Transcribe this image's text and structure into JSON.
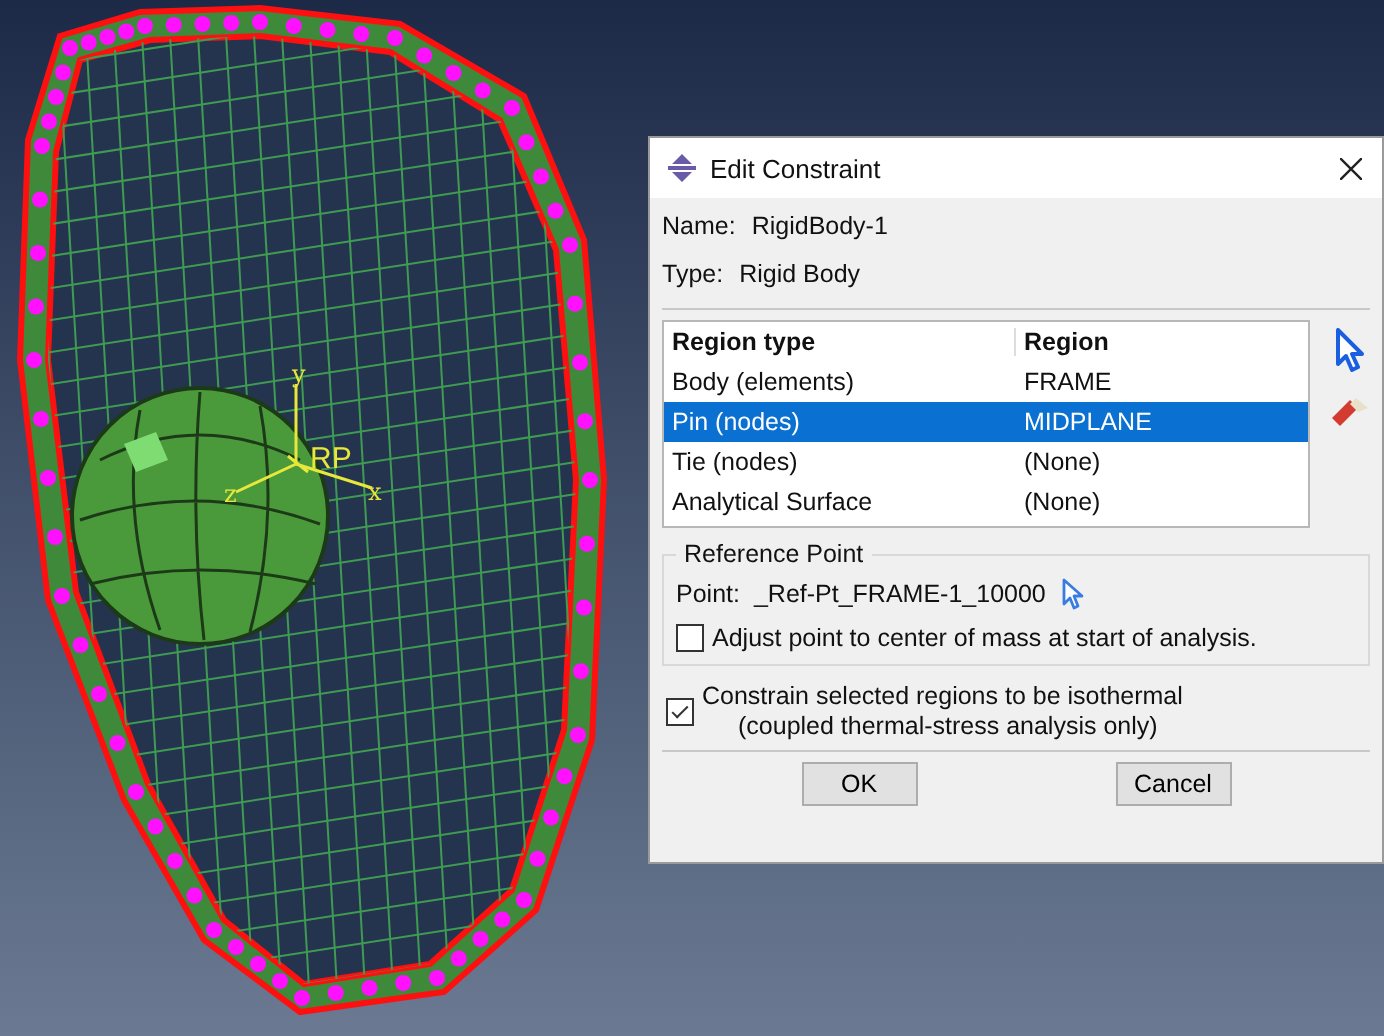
{
  "viewport": {
    "triad_labels": [
      "y",
      "x",
      "z"
    ],
    "reference_point_label": "RP"
  },
  "dialog": {
    "title": "Edit Constraint",
    "name_label": "Name:",
    "name_value": "RigidBody-1",
    "type_label": "Type:",
    "type_value": "Rigid Body",
    "table": {
      "columns": [
        "Region type",
        "Region"
      ],
      "rows": [
        {
          "cells": [
            "Body (elements)",
            "FRAME"
          ],
          "selected": false
        },
        {
          "cells": [
            "Pin (nodes)",
            "MIDPLANE"
          ],
          "selected": true
        },
        {
          "cells": [
            "Tie (nodes)",
            "(None)"
          ],
          "selected": false
        },
        {
          "cells": [
            "Analytical Surface",
            "(None)"
          ],
          "selected": false
        }
      ]
    },
    "reference_point": {
      "legend": "Reference Point",
      "point_label": "Point:",
      "point_value": "_Ref-Pt_FRAME-1_10000",
      "adjust": {
        "label": "Adjust point to center of mass at start of analysis.",
        "checked": false
      }
    },
    "isothermal": {
      "label": "Constrain selected regions to be isothermal",
      "note": "(coupled thermal-stress analysis only)",
      "checked": true
    },
    "buttons": [
      "OK",
      "Cancel"
    ]
  }
}
